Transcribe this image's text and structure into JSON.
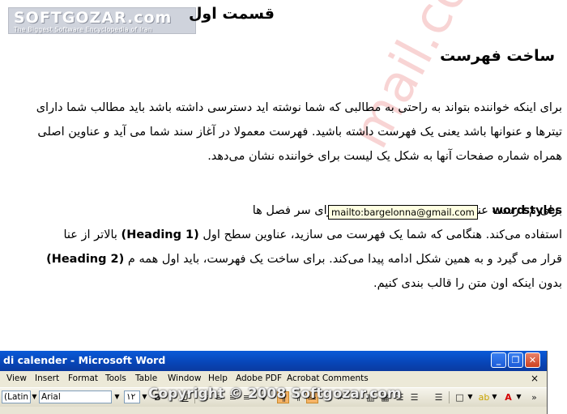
{
  "logo": {
    "name": "SOFTGOZAR.com",
    "tagline": "The Biggest Software Encyclopedia of Iran"
  },
  "headings": {
    "part": "قسمت اول",
    "section": "ساخت فهرست"
  },
  "paragraph1": {
    "lines": [
      "برای اینکه خواننده بتواند به راحتی به مطالبی که شما نوشته اید دسترسی داشته باشد باید مطالب شما دارای",
      "تیترها و عنوانها باشد یعنی یک فهرست داشته باشید. فهرست معمولا در آغاز سند شما می آید و عناوین اصلی",
      "همراه شماره صفحات آنها به شکل یک لیست برای خواننده نشان می‌دهد."
    ]
  },
  "paragraph2": {
    "line1_bold_end": "styles",
    "line1_text": "رست عنوانها از استیل های بکار رفته برای سر فصل ها",
    "line1_gap": "",
    "line1_prefix": "برای م",
    "line1_bold_start": "word",
    "line2_a": "استفاده می‌کند.  هنگامی که شما یک فهرست می سازید، عناوین سطح اول",
    "line2_bold": "(Heading 1)",
    "line2_b": "بالاتر از عنا",
    "line3_bold": "(Heading 2)",
    "line3_text": "قرار می گیرد و به همین شکل ادامه پیدا می‌کند.  برای ساخت یک فهرست، باید اول همه م",
    "line4": "بدون اینکه اون متن را قالب بندی کنیم."
  },
  "tooltip": "mailto:bargelonna@gmail.com",
  "watermark": {
    "side": "mail.com",
    "footer": "Copyright © 2008 Softgozar.com"
  },
  "word_window": {
    "title": "di calender - Microsoft Word",
    "buttons": {
      "minimize": "_",
      "maximize": "❐",
      "close": "✕"
    },
    "menu": [
      "View",
      "Insert",
      "Format",
      "Tools",
      "Table",
      "Window",
      "Help",
      "Adobe PDF",
      "Acrobat Comments"
    ],
    "menu_close": "×",
    "toolbar": {
      "script_box": "(Latin",
      "font_box": "Arial",
      "size_box": "۱۲"
    }
  },
  "colors": {
    "title_bar": "#0845b6",
    "tooltip_bg": "#ffffe1",
    "highlight": "#f5b366"
  }
}
